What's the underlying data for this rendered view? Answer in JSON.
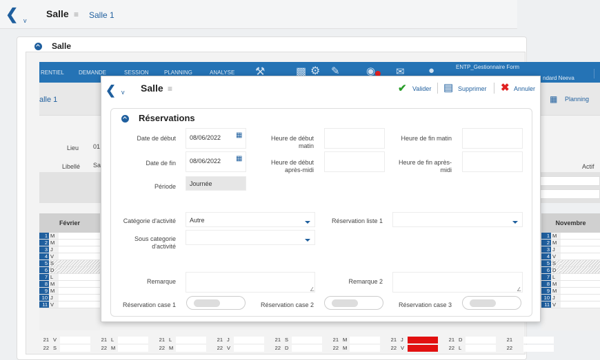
{
  "topbar": {
    "title": "Salle",
    "subtitle": "Salle 1"
  },
  "card": {
    "title": "Salle"
  },
  "nav": {
    "items": [
      "RENTIEL",
      "DEMANDE",
      "SESSION",
      "PLANNING",
      "ANALYSE"
    ],
    "user_role": "ENTP_Gestionnaire Form",
    "user_name": "ndard Neeva"
  },
  "subbar": {
    "title": "alle 1",
    "planning": "Planning"
  },
  "bg_form": {
    "lieu": "Lieu",
    "lieu_val": "01",
    "libelle": "Libellé",
    "libelle_val": "Sa",
    "actif": "Actif"
  },
  "calendar": {
    "left": {
      "month": "Février",
      "rows": [
        [
          "1",
          "M"
        ],
        [
          "2",
          "M"
        ],
        [
          "3",
          "J"
        ],
        [
          "4",
          "V"
        ],
        [
          "5",
          "S"
        ],
        [
          "6",
          "D"
        ],
        [
          "7",
          "L"
        ],
        [
          "8",
          "M"
        ],
        [
          "9",
          "M"
        ],
        [
          "10",
          "J"
        ],
        [
          "11",
          "V"
        ]
      ]
    },
    "right": {
      "month": "Novembre",
      "rows": [
        [
          "1",
          "M"
        ],
        [
          "2",
          "M"
        ],
        [
          "3",
          "J"
        ],
        [
          "4",
          "V"
        ],
        [
          "5",
          "S"
        ],
        [
          "6",
          "D"
        ],
        [
          "7",
          "L"
        ],
        [
          "8",
          "M"
        ],
        [
          "9",
          "M"
        ],
        [
          "10",
          "J"
        ],
        [
          "11",
          "V"
        ]
      ]
    },
    "bottom": [
      [
        [
          "21",
          "V"
        ],
        [
          "21",
          "L"
        ],
        [
          "21",
          "L"
        ],
        [
          "21",
          "J"
        ],
        [
          "21",
          "S"
        ],
        [
          "21",
          "M"
        ],
        [
          "21",
          "J"
        ],
        [
          "21",
          "D"
        ],
        [
          "21",
          ""
        ]
      ],
      [
        [
          "22",
          "S"
        ],
        [
          "22",
          "M"
        ],
        [
          "22",
          "M"
        ],
        [
          "22",
          "V"
        ],
        [
          "22",
          "D"
        ],
        [
          "22",
          "M"
        ],
        [
          "22",
          "V"
        ],
        [
          "22",
          "L"
        ],
        [
          "22",
          ""
        ]
      ]
    ]
  },
  "modal": {
    "title": "Salle",
    "actions": {
      "validate": "Valider",
      "delete": "Supprimer",
      "cancel": "Annuler"
    }
  },
  "section": {
    "title": "Réservations"
  },
  "form": {
    "date_debut_label": "Date de début",
    "date_debut": "08/06/2022",
    "date_fin_label": "Date de fin",
    "date_fin": "08/06/2022",
    "periode_label": "Période",
    "periode": "Journée",
    "heure_debut_matin_label": "Heure de début matin",
    "heure_debut_am_label": "Heure de début après-midi",
    "heure_fin_matin_label": "Heure de fin matin",
    "heure_fin_am_label": "Heure de fin après-midi",
    "categorie_label": "Catégorie d'activité",
    "categorie": "Autre",
    "sous_categorie_label": "Sous categorie d'activité",
    "reservation_liste1_label": "Réservation liste 1",
    "remarque_label": "Remarque",
    "remarque2_label": "Remarque 2",
    "case1_label": "Réservation case 1",
    "case2_label": "Réservation case 2",
    "case3_label": "Réservation case 3"
  },
  "colors": {
    "accent": "#1f5f9e",
    "nav": "#2573b5",
    "validate": "#2a9d2a",
    "delete": "#1f5f9e",
    "cancel": "#e02020",
    "red_cell": "#e21010"
  },
  "icons": [
    "chevron-left-icon",
    "hamburger-icon",
    "calendar-icon",
    "check-icon",
    "trash-icon",
    "close-icon",
    "chevron-down-icon",
    "collapse-icon"
  ]
}
